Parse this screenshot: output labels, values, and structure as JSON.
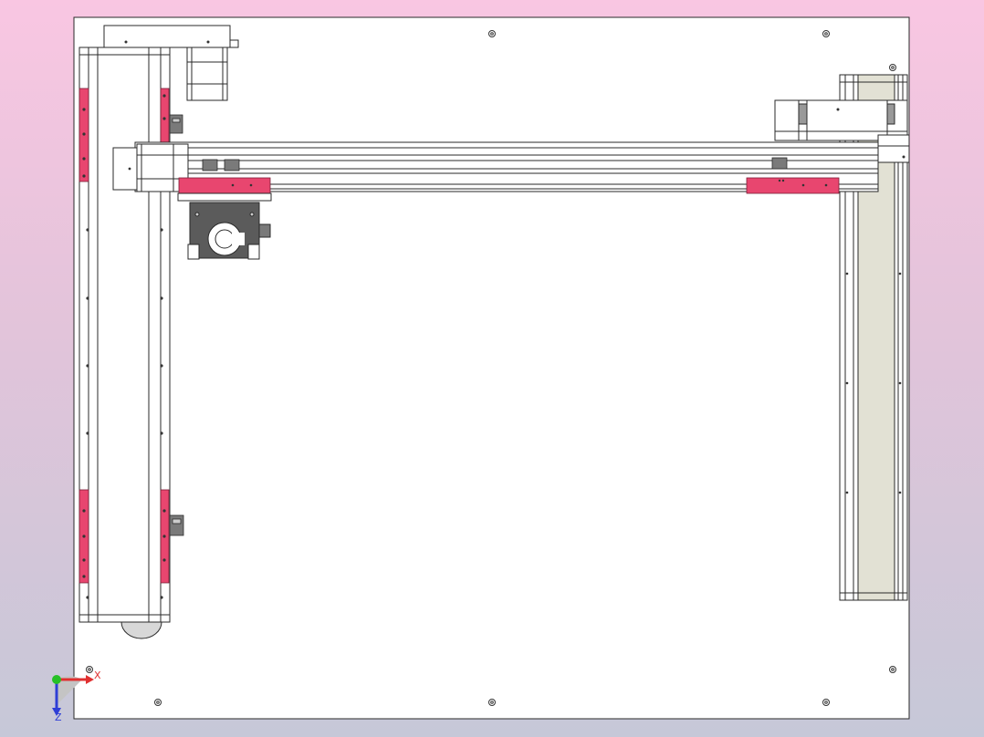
{
  "viewport": {
    "background_top": "#f9c6e2",
    "background_bottom": "#c6c8d8"
  },
  "colors": {
    "plate": "#ffffff",
    "outline": "#2a2a2a",
    "rail_highlight": "#e8466f",
    "carriage_dark": "#5b5b5b",
    "beige_rail": "#e2e1d4",
    "axis_x": "#e03030",
    "axis_y": "#26c026",
    "axis_z": "#2f3fd6"
  },
  "triad": {
    "x_label": "X",
    "z_label": "Z",
    "icons": [
      "origin-triad-icon",
      "x-arrow-icon",
      "z-arrow-icon"
    ]
  }
}
